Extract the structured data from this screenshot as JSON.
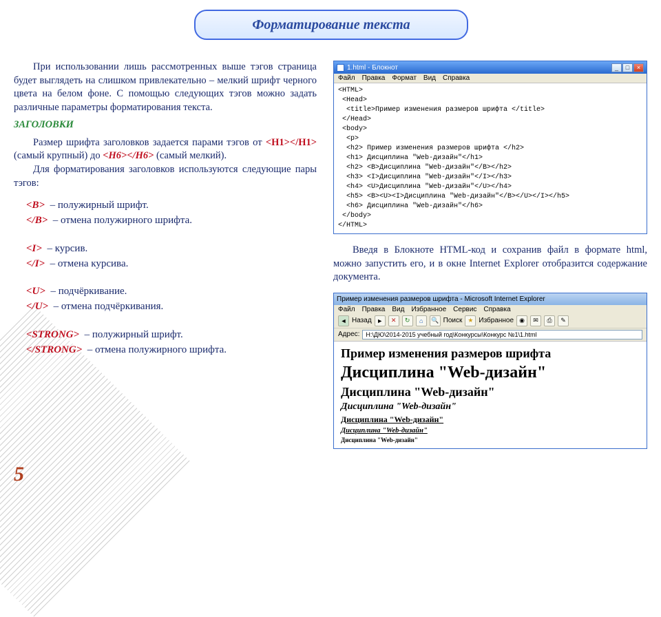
{
  "title": "Форматирование текста",
  "page_number": "5",
  "left": {
    "p1": "При использовании лишь рассмотренных выше тэгов страница будет выглядеть на слишком привлекательно – мелкий шрифт черного цвета на белом фоне. С помощью следующих тэгов можно задать различные параметры форматирования текста.",
    "subhead": "ЗАГОЛОВКИ",
    "p2a": "Размер шрифта заголовков задается парами тэгов от ",
    "p2_h1o": "<H1>",
    "p2_h1c": "</H1>",
    "p2b": " (самый крупный) до ",
    "p2_h6o": "<H6>",
    "p2_h6c": "</H6>",
    "p2c": " (самый мелкий).",
    "p3": "Для форматирования заголовков используются следующие  пары тэгов:"
  },
  "tags": {
    "b_open": "<B>",
    "b_open_desc": "– полужирный шрифт.",
    "b_close": "</B>",
    "b_close_desc": "– отмена полужирного шрифта.",
    "i_open": "<I>",
    "i_open_desc": "– курсив.",
    "i_close": "</I>",
    "i_close_desc": "– отмена курсива.",
    "u_open": "<U>",
    "u_open_desc": "– подчёркивание.",
    "u_close": "</U>",
    "u_close_desc": "– отмена подчёркивания.",
    "s_open": "<STRONG>",
    "s_open_desc": "– полужирный шрифт.",
    "s_close": "</STRONG>",
    "s_close_desc": "–  отмена полужирного шрифта."
  },
  "notepad": {
    "title": "1.html - Блокнот",
    "min": "_",
    "max": "□",
    "close": "×",
    "menu": [
      "Файл",
      "Правка",
      "Формат",
      "Вид",
      "Справка"
    ],
    "code": "<HTML>\n <Head>\n  <title>Пример изменения размеров шрифта </title>\n </Head>\n <body>\n  <p>\n  <h2> Пример изменения размеров шрифта </h2>\n  <h1> Дисциплина \"Web-дизайн\"</h1>\n  <h2> <B>Дисциплина \"Web-дизайн\"</B></h2>\n  <h3> <I>Дисциплина \"Web-дизайн\"</I></h3>\n  <h4> <U>Дисциплина \"Web-дизайн\"</U></h4>\n  <h5> <B><U><I>Дисциплина \"Web-дизайн\"</B></U></I></h5>\n  <h6> Дисциплина \"Web-дизайн\"</h6>\n </body>\n</HTML>"
  },
  "right_text": "Введя в Блокноте HTML-код  и сохранив файл в формате html, можно запустить его, и в окне Internet Explorer отобразится содержание документа.",
  "ie": {
    "title": "Пример изменения размеров шрифта - Microsoft Internet Explorer",
    "menu": [
      "Файл",
      "Правка",
      "Вид",
      "Избранное",
      "Сервис",
      "Справка"
    ],
    "back": "Назад",
    "search": "Поиск",
    "fav": "Избранное",
    "addr_label": "Адрес:",
    "addr": "H:\\ДЮ\\2014-2015 учебный год\\Конкурсы\\Конкурс №1\\1.html",
    "h2": "Пример изменения размеров шрифта",
    "h1": "Дисциплина \"Web-дизайн\"",
    "h2b": "Дисциплина \"Web-дизайн\"",
    "h3": "Дисциплина \"Web-дизайн\"",
    "h4": "Дисциплина \"Web-дизайн\"",
    "h5": "Дисциплина \"Web-дизайн\"",
    "h6": "Дисциплина \"Web-дизайн\""
  }
}
